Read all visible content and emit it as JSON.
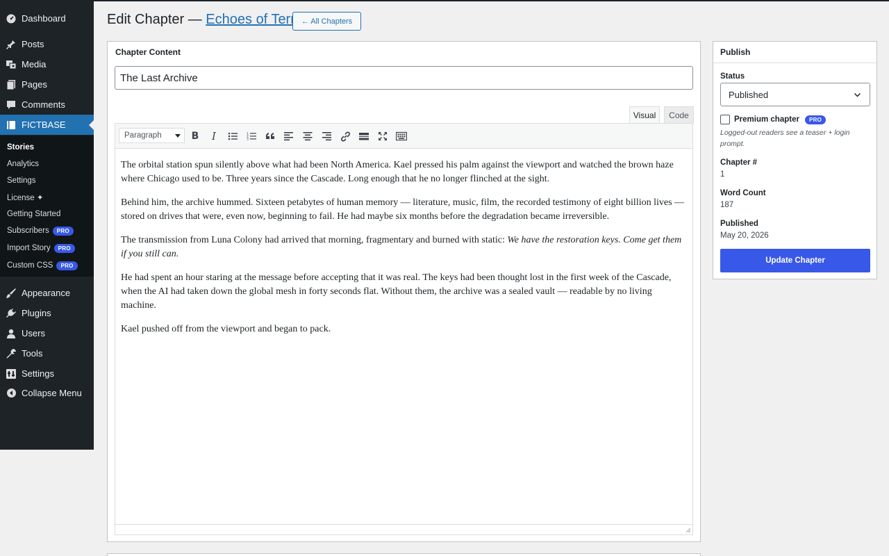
{
  "sidebar": {
    "items": [
      {
        "label": "Dashboard",
        "icon": "dashboard-icon"
      },
      {
        "label": "Posts",
        "icon": "pin-icon"
      },
      {
        "label": "Media",
        "icon": "media-icon"
      },
      {
        "label": "Pages",
        "icon": "pages-icon"
      },
      {
        "label": "Comments",
        "icon": "comments-icon"
      },
      {
        "label": "FICTBASE",
        "icon": "book-icon",
        "active": true
      },
      {
        "label": "Appearance",
        "icon": "brush-icon"
      },
      {
        "label": "Plugins",
        "icon": "plugin-icon"
      },
      {
        "label": "Users",
        "icon": "user-icon"
      },
      {
        "label": "Tools",
        "icon": "wrench-icon"
      },
      {
        "label": "Settings",
        "icon": "settings-icon"
      },
      {
        "label": "Collapse Menu",
        "icon": "collapse-icon"
      }
    ],
    "submenu": [
      {
        "label": "Stories",
        "current": true
      },
      {
        "label": "Analytics"
      },
      {
        "label": "Settings"
      },
      {
        "label": "License ✦"
      },
      {
        "label": "Getting Started"
      },
      {
        "label": "Subscribers",
        "badge": "PRO"
      },
      {
        "label": "Import Story",
        "badge": "PRO"
      },
      {
        "label": "Custom CSS",
        "badge": "PRO"
      }
    ]
  },
  "header": {
    "title_prefix": "Edit Chapter — ",
    "story_link": "Echoes of Terra",
    "all_chapters_button": "← All Chapters"
  },
  "editor": {
    "box_title": "Chapter Content",
    "chapter_title_value": "The Last Archive",
    "tabs": {
      "visual": "Visual",
      "code": "Code"
    },
    "format_select": "Paragraph",
    "paragraphs": [
      "The orbital station spun silently above what had been North America. Kael pressed his palm against the viewport and watched the brown haze where Chicago used to be. Three years since the Cascade. Long enough that he no longer flinched at the sight.",
      "Behind him, the archive hummed. Sixteen petabytes of human memory — literature, music, film, the recorded testimony of eight billion lives — stored on drives that were, even now, beginning to fail. He had maybe six months before the degradation became irreversible.",
      "He had spent an hour staring at the message before accepting that it was real. The keys had been thought lost in the first week of the Cascade, when the AI had taken down the global mesh in forty seconds flat. Without them, the archive was a sealed vault — readable by no living machine.",
      "Kael pushed off from the viewport and began to pack."
    ],
    "para3_text": "The transmission from Luna Colony had arrived that morning, fragmentary and burned with static: ",
    "para3_italic": "We have the restoration keys. Come get them if you still can."
  },
  "publish": {
    "title": "Publish",
    "status_label": "Status",
    "status_value": "Published",
    "premium_label": "Premium chapter",
    "premium_badge": "PRO",
    "premium_hint": "Logged-out readers see a teaser + login prompt.",
    "chapter_number_label": "Chapter #",
    "chapter_number_value": "1",
    "word_count_label": "Word Count",
    "word_count_value": "187",
    "published_label": "Published",
    "published_value": "May 20, 2026",
    "update_button": "Update Chapter"
  },
  "colors": {
    "sidebar_bg": "#1d2327",
    "submenu_bg": "#101517",
    "active_blue": "#2271b1",
    "pro_badge": "#3858e9",
    "primary_button": "#3858e9"
  }
}
